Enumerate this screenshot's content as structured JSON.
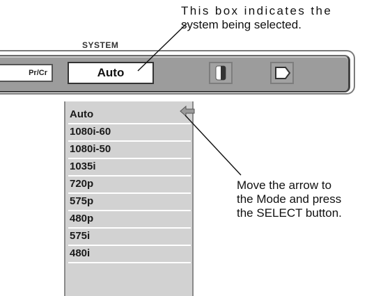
{
  "callouts": {
    "top_line1": "This box indicates the",
    "top_line2": "system being selected.",
    "right_line1": "Move the arrow to",
    "right_line2": "the Mode and press",
    "right_line3": "the SELECT button."
  },
  "menu": {
    "title": "SYSTEM",
    "prev_tab": "Pr/Cr",
    "selected_system": "Auto",
    "icons": [
      "image-adjust-icon",
      "exit-icon"
    ]
  },
  "dropdown": {
    "items": [
      "Auto",
      "1080i-60",
      "1080i-50",
      "1035i",
      "720p",
      "575p",
      "480p",
      "575i",
      "480i"
    ],
    "pointer_on": "Auto"
  }
}
